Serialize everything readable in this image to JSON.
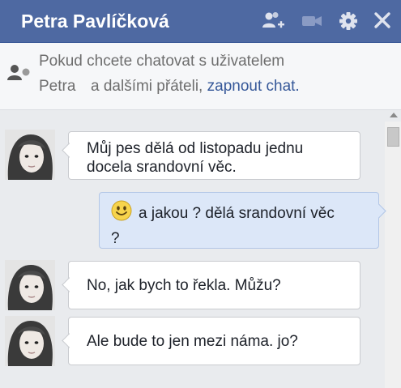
{
  "header": {
    "title": "Petra Pavlíčková",
    "icons": [
      "add-friend-icon",
      "video-call-icon",
      "gear-icon",
      "close-icon"
    ]
  },
  "notice": {
    "line1": "Pokud chcete chatovat s uživatelem",
    "name": "Petra",
    "rest": "a dalšími přáteli,",
    "link": "zapnout chat."
  },
  "messages": [
    {
      "direction": "in",
      "line1": "Můj pes dělá od listopadu jednu",
      "line2": "docela srandovní věc."
    },
    {
      "direction": "out",
      "emoji": "smiley-icon",
      "line1": "a jakou ? dělá srandovní věc",
      "line2": "?"
    },
    {
      "direction": "in",
      "line1": "No, jak bych to řekla. Můžu?"
    },
    {
      "direction": "in",
      "line1": "Ale bude to jen mezi náma. jo?"
    }
  ],
  "colors": {
    "header_bg": "#4e69a2",
    "link": "#365899",
    "outgoing_bubble": "#dce7f8",
    "chat_bg": "#e9ebee"
  }
}
